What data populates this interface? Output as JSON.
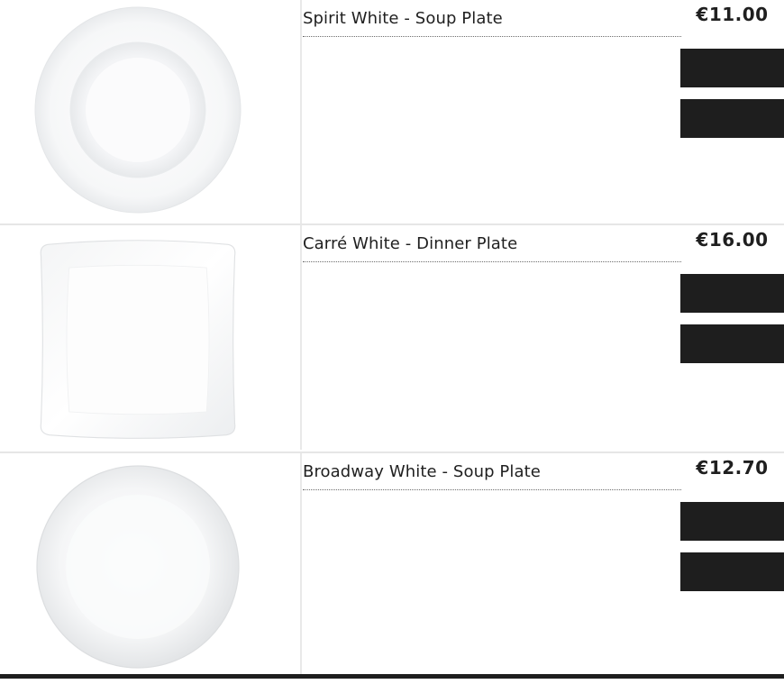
{
  "products": [
    {
      "name": "Spirit White - Soup Plate",
      "price": "€11.00",
      "image_icon": "round-soup-plate-image"
    },
    {
      "name": "Carré White - Dinner Plate",
      "price": "€16.00",
      "image_icon": "square-dinner-plate-image"
    },
    {
      "name": "Broadway White - Soup Plate",
      "price": "€12.70",
      "image_icon": "round-coupe-plate-image"
    }
  ],
  "colors": {
    "button": "#1e1e1e",
    "divider": "#e6e6e6",
    "text": "#1f1f1f"
  }
}
